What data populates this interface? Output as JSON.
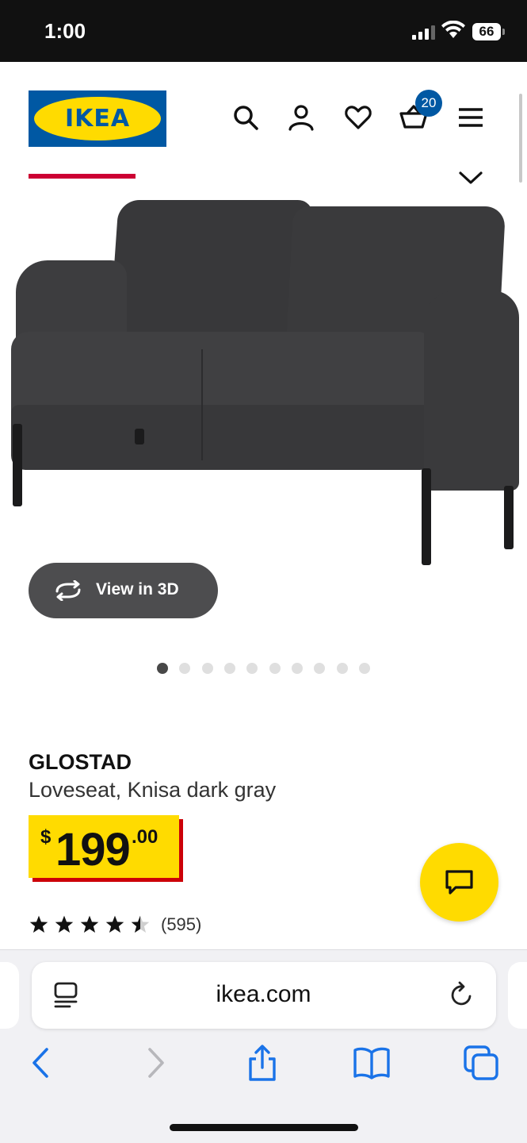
{
  "status_bar": {
    "time": "1:00",
    "battery": "66"
  },
  "header": {
    "logo_text": "IKEA",
    "cart_count": "20",
    "icons": [
      "search-icon",
      "profile-icon",
      "heart-icon",
      "cart-icon",
      "menu-icon"
    ]
  },
  "colors": {
    "ikea_blue": "#0058a3",
    "ikea_yellow": "#ffdb00",
    "accent_red": "#cc0033",
    "price_shadow": "#cc0008",
    "safari_blue": "#1a73e8"
  },
  "media": {
    "view_3d_label": "View in 3D",
    "image_count": 10,
    "active_image": 1
  },
  "product": {
    "name": "GLOSTAD",
    "description": "Loveseat, Knisa dark gray",
    "price": {
      "currency": "$",
      "whole": "199",
      "cents": ".00"
    },
    "rating": {
      "stars": 4.5,
      "count": "(595)"
    }
  },
  "browser": {
    "url": "ikea.com",
    "nav_icons": [
      "back-icon",
      "forward-icon",
      "share-icon",
      "bookmarks-icon",
      "tabs-icon"
    ]
  }
}
